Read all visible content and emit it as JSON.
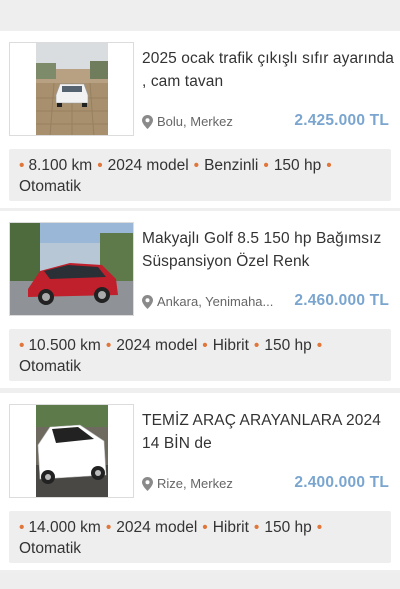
{
  "listings": [
    {
      "title": "2025 ocak trafik çıkışlı sıfır ayarında , cam tavan",
      "location": "Bolu, Merkez",
      "price": "2.425.000 TL",
      "specs": [
        "8.100 km",
        "2024 model",
        "Benzinli",
        "150 hp",
        "Otomatik"
      ],
      "car_color": "#f2f2f2"
    },
    {
      "title": "Makyajlı Golf 8.5 150 hp Bağımsız Süspansiyon Özel Renk",
      "location": "Ankara, Yenimaha...",
      "price": "2.460.000 TL",
      "specs": [
        "10.500 km",
        "2024 model",
        "Hibrit",
        "150 hp",
        "Otomatik"
      ],
      "car_color": "#c0202b"
    },
    {
      "title": "TEMİZ ARAÇ ARAYANLARA 2024 14 BİN de",
      "location": "Rize, Merkez",
      "price": "2.400.000 TL",
      "specs": [
        "14.000 km",
        "2024 model",
        "Hibrit",
        "150 hp",
        "Otomatik"
      ],
      "car_color": "#ffffff"
    }
  ],
  "colors": {
    "price": "#7aa5cf",
    "spec_bullet": "#e0763a",
    "spec_background": "#eeeeee"
  },
  "icons": {
    "location": "map-pin-icon"
  }
}
